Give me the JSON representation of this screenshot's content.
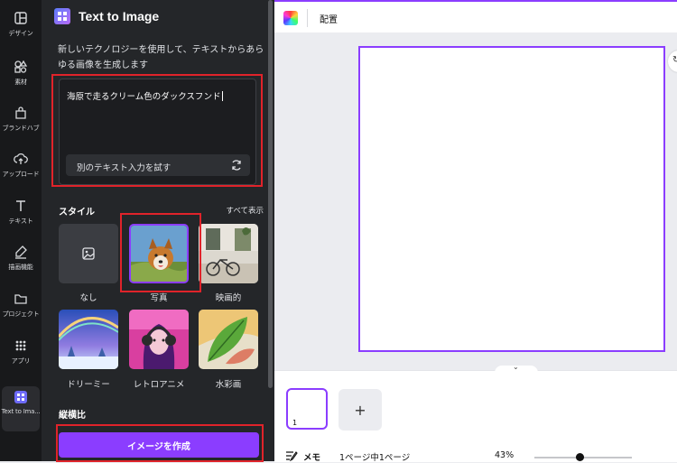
{
  "sidebar": {
    "items": [
      {
        "label": "デザイン",
        "icon": "layout-icon"
      },
      {
        "label": "素材",
        "icon": "elements-icon"
      },
      {
        "label": "ブランドハブ",
        "icon": "brand-icon"
      },
      {
        "label": "アップロード",
        "icon": "upload-icon"
      },
      {
        "label": "テキスト",
        "icon": "text-icon"
      },
      {
        "label": "描画機能",
        "icon": "draw-icon"
      },
      {
        "label": "プロジェクト",
        "icon": "folder-icon"
      },
      {
        "label": "アプリ",
        "icon": "apps-icon"
      },
      {
        "label": "Text to Ima...",
        "icon": "text-to-image-icon"
      }
    ]
  },
  "panel": {
    "title": "Text to Image",
    "description": "新しいテクノロジーを使用して、テキストからあらゆる画像を生成します",
    "prompt_value": "海原で走るクリーム色のダックスフンド",
    "retry_label": "別のテキスト入力を試す",
    "style_heading": "スタイル",
    "show_all": "すべて表示",
    "styles": [
      {
        "label": "なし",
        "selected": false
      },
      {
        "label": "写真",
        "selected": true
      },
      {
        "label": "映画的",
        "selected": false
      },
      {
        "label": "ドリーミー",
        "selected": false
      },
      {
        "label": "レトロアニメ",
        "selected": false
      },
      {
        "label": "水彩画",
        "selected": false
      }
    ],
    "aspect_heading": "縦横比",
    "create_button": "イメージを作成"
  },
  "topbar": {
    "arrange_label": "配置"
  },
  "pages": {
    "thumbnail_number": "1",
    "add_symbol": "+"
  },
  "footer": {
    "memo_label": "メモ",
    "page_count": "1ページ中1ページ",
    "zoom": "43%",
    "zoom_level": 0.43
  },
  "colors": {
    "accent": "#8b3dff",
    "highlight": "#e0232a",
    "panel_bg": "#242629",
    "rail_bg": "#18191b"
  }
}
